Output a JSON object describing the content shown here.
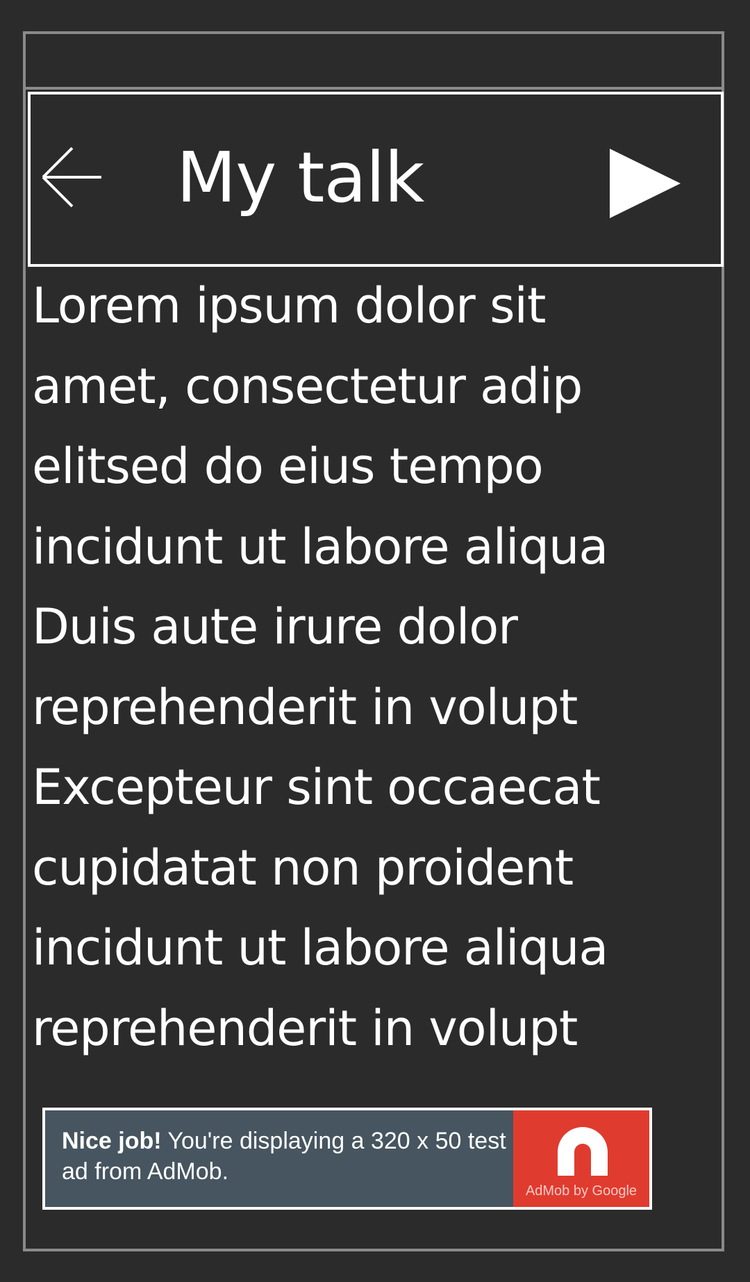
{
  "header": {
    "title": "My talk",
    "back_icon": "arrow-left-icon",
    "play_icon": "play-icon"
  },
  "content": {
    "lines": [
      "Lorem ipsum dolor sit",
      "amet, consectetur adip",
      "elitsed do eius tempo",
      "incidunt ut labore aliqua",
      "Duis aute irure dolor",
      "reprehenderit in volupt",
      "Excepteur sint occaecat",
      "cupidatat non proident",
      "incidunt ut labore aliqua",
      "reprehenderit in volupt"
    ]
  },
  "ad": {
    "bold_text": "Nice job!",
    "text": " You're displaying a 320 x 50 test ad from AdMob.",
    "logo_caption": "AdMob by Google",
    "logo_icon": "admob-logo-icon"
  },
  "colors": {
    "background": "#2b2b2b",
    "frame_border": "#8a8a8a",
    "text": "#ffffff",
    "ad_background": "#46555f",
    "ad_logo_background": "#e03b2f"
  }
}
